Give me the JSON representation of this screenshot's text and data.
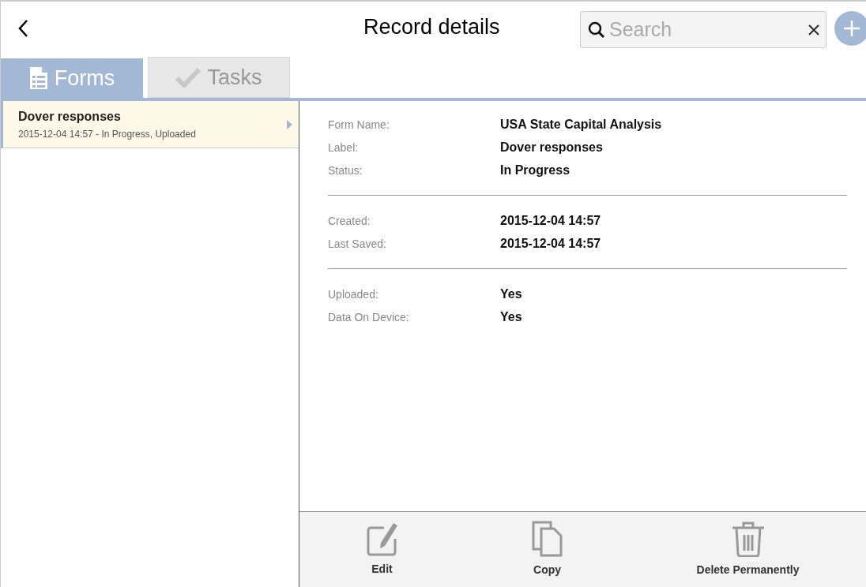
{
  "header": {
    "title": "Record details",
    "search": {
      "placeholder": "Search"
    }
  },
  "tabs": [
    {
      "label": "Forms",
      "kind": "form",
      "selected": true
    },
    {
      "label": "Tasks",
      "kind": "check",
      "selected": false
    }
  ],
  "records": [
    {
      "title": "Dover responses",
      "subtitle": "2015-12-04 14:57 - In Progress, Uploaded",
      "selected": true
    }
  ],
  "details": [
    [
      {
        "label": "Form Name:",
        "value": "USA State Capital Analysis"
      },
      {
        "label": "Label:",
        "value": "Dover responses"
      },
      {
        "label": "Status:",
        "value": "In Progress"
      }
    ],
    [
      {
        "label": "Created:",
        "value": "2015-12-04 14:57"
      },
      {
        "label": "Last Saved:",
        "value": "2015-12-04 14:57"
      }
    ],
    [
      {
        "label": "Uploaded:",
        "value": "Yes"
      },
      {
        "label": "Data On Device:",
        "value": "Yes"
      }
    ]
  ],
  "actions": [
    {
      "label": "Edit",
      "kind": "edit"
    },
    {
      "label": "Copy",
      "kind": "copy"
    },
    {
      "label": "Delete Permanently",
      "kind": "delete"
    }
  ]
}
